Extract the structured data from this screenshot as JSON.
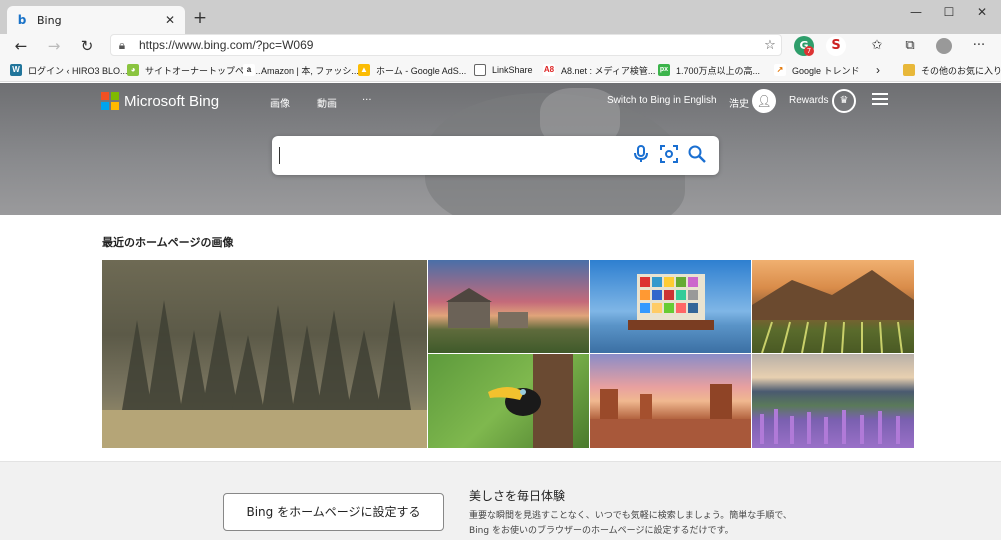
{
  "browser": {
    "tab_title": "Bing",
    "tab_favicon": "bing-b-icon",
    "url": "https://www.bing.com/?pc=W069",
    "window_controls": [
      "minimize",
      "maximize",
      "close"
    ],
    "extension_badge": "7"
  },
  "bookmarks": [
    {
      "icon": "wordpress-icon",
      "label": "ログイン ‹ HIRO3 BLO..."
    },
    {
      "icon": "owl-icon",
      "label": "サイトオーナートップペー..."
    },
    {
      "icon": "amazon-icon",
      "label": "Amazon | 本, ファッシ..."
    },
    {
      "icon": "google-ads-icon",
      "label": "ホーム - Google AdS..."
    },
    {
      "icon": "page-icon",
      "label": "LinkShare"
    },
    {
      "icon": "a8-icon",
      "label": "A8.net : メディア検管..."
    },
    {
      "icon": "px-icon",
      "label": "1.700万点以上の高..."
    },
    {
      "icon": "trends-icon",
      "label": "Google トレンド"
    },
    {
      "icon": "folder-icon",
      "label": "その他のお気に入り"
    }
  ],
  "bing": {
    "brand": "Microsoft Bing",
    "nav": [
      "画像",
      "動画",
      "···"
    ],
    "switch_lang": "Switch to Bing in English",
    "user_name": "浩史",
    "rewards": "Rewards",
    "search_placeholder": ""
  },
  "recent": {
    "title": "最近のホームページの画像"
  },
  "bottom": {
    "set_button": "Bing をホームページに設定する",
    "title": "美しさを毎日体験",
    "description": "重要な瞬間を見逃すことなく、いつでも気軽に検索しましょう。簡単な手順で、Bing をお使いのブラウザーのホームページに設定するだけです。"
  },
  "colors": {
    "accent": "#1a6fd1",
    "ms_red": "#f25022",
    "ms_green": "#7fba00",
    "ms_blue": "#00a4ef",
    "ms_yellow": "#ffb900"
  }
}
